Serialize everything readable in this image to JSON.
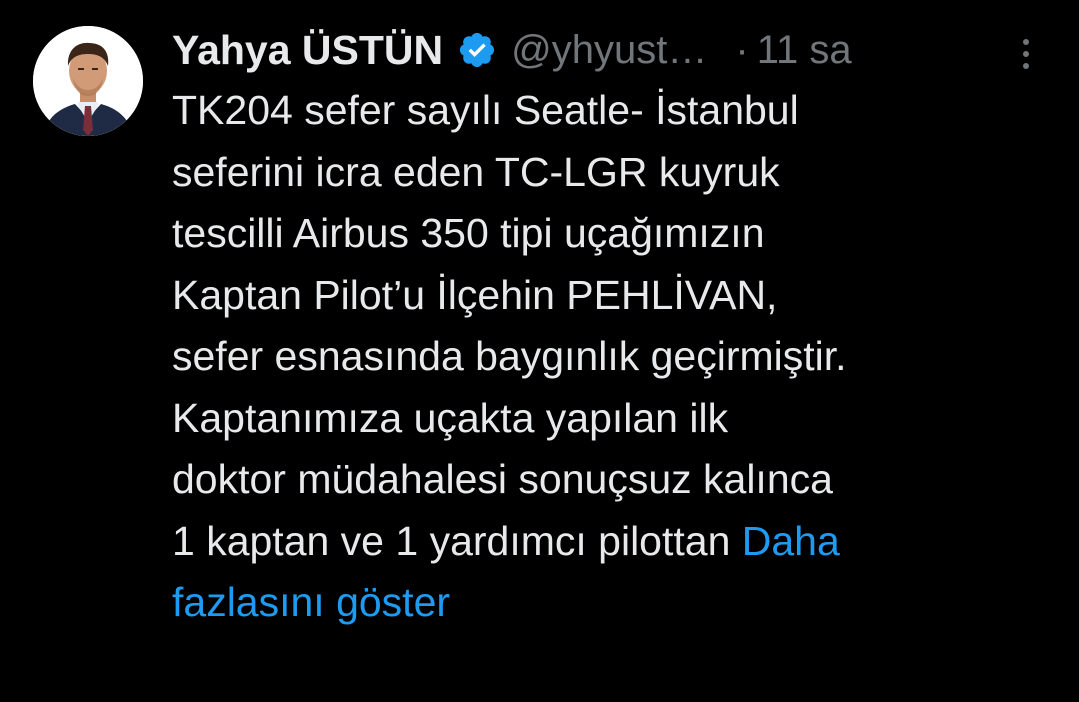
{
  "tweet": {
    "author": {
      "display_name": "Yahya ÜSTÜN",
      "handle": "@yhyust…",
      "verified_icon": "verified-badge-icon",
      "avatar_icon": "profile-avatar"
    },
    "separator": "·",
    "time": "11 sa",
    "more_icon": "more-vertical-icon",
    "body_lines": [
      "TK204 sefer sayılı Seatle- İstanbul",
      "seferini icra eden TC-LGR kuyruk",
      "tescilli Airbus 350 tipi uçağımızın",
      "Kaptan Pilot’u İlçehin PEHLİVAN,",
      "sefer esnasında baygınlık geçirmiştir.",
      "Kaptanımıza uçakta yapılan ilk",
      "doktor müdahalesi sonuçsuz kalınca",
      "1 kaptan ve 1 yardımcı pilottan "
    ],
    "show_more_line1": "Daha",
    "show_more_line2": "fazlasını göster"
  },
  "colors": {
    "background": "#000000",
    "text": "#e7e9ea",
    "secondary": "#71767b",
    "link": "#1d9bf0",
    "verified": "#1d9bf0"
  }
}
